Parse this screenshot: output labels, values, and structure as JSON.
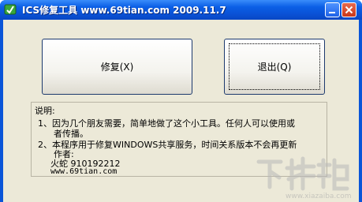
{
  "window": {
    "title": "ICS修复工具 www.69tian.com 2009.11.7",
    "minimize_icon": "minimize-icon",
    "close_icon": "close-icon",
    "app_icon": "app-icon"
  },
  "buttons": {
    "repair_label": "修复(X)",
    "exit_label": "退出(Q)"
  },
  "description": {
    "heading": "说明:",
    "line1": "1、因为几个朋友需要，简单地做了这个小工具。任何人可以使用或",
    "line1b": "者传播。",
    "line2": "2、本程序用于修复WINDOWS共享服务，时间关系版本不会再更新",
    "author_label": "作者:",
    "author_name": "火蛇  910192212",
    "website": "www.69tian.com"
  },
  "watermark": {
    "text": "下载吧",
    "url": "www.xiazaiba.com"
  },
  "colors": {
    "titlebar": "#0a52d6",
    "face": "#ece9d8",
    "close_button": "#c8371a"
  }
}
